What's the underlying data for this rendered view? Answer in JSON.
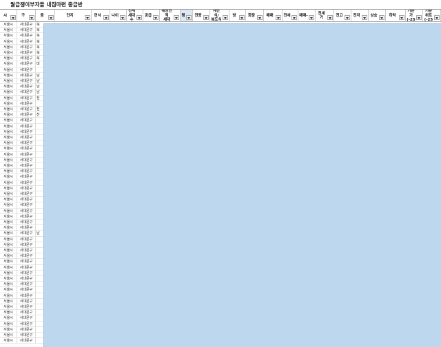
{
  "sheet": {
    "title": "월급쟁이부자들 내집마련 중급반"
  },
  "columns": [
    {
      "label": "시"
    },
    {
      "label": "구"
    },
    {
      "label": "동"
    },
    {
      "label": "단지"
    },
    {
      "label": "연식"
    },
    {
      "label": "나이"
    },
    {
      "label": "전체\n세대수"
    },
    {
      "label": "공급"
    },
    {
      "label": "해당면적\n세대"
    },
    {
      "label": "평"
    },
    {
      "label": "전용"
    },
    {
      "label": "계단식/\n복도식"
    },
    {
      "label": "방"
    },
    {
      "label": "화장"
    },
    {
      "label": "매매"
    },
    {
      "label": "전세"
    },
    {
      "label": "매매-"
    },
    {
      "label": "전세가"
    },
    {
      "label": "전고"
    },
    {
      "label": "전저"
    },
    {
      "label": "상승"
    },
    {
      "label": "하락"
    },
    {
      "label": "기준가\n(-25"
    },
    {
      "label": "기준위트\n(-25"
    }
  ],
  "rows": [
    {
      "city": "서울시",
      "district": "서대문구",
      "dong": "북"
    },
    {
      "city": "서울시",
      "district": "서대문구",
      "dong": "북"
    },
    {
      "city": "서울시",
      "district": "서대문구",
      "dong": "북"
    },
    {
      "city": "서울시",
      "district": "서대문구",
      "dong": "북"
    },
    {
      "city": "서울시",
      "district": "서대문구",
      "dong": "북"
    },
    {
      "city": "서울시",
      "district": "서대문구",
      "dong": "북"
    },
    {
      "city": "서울시",
      "district": "서대문구",
      "dong": "북"
    },
    {
      "city": "서울시",
      "district": "서대문구",
      "dong": "대"
    },
    {
      "city": "서울시",
      "district": "서대문구",
      "dong": ""
    },
    {
      "city": "서울시",
      "district": "서대문구",
      "dong": "남"
    },
    {
      "city": "서울시",
      "district": "서대문구",
      "dong": "남"
    },
    {
      "city": "서울시",
      "district": "서대문구",
      "dong": "남"
    },
    {
      "city": "서울시",
      "district": "서대문구",
      "dong": "남"
    },
    {
      "city": "서울시",
      "district": "서대문구",
      "dong": "천"
    },
    {
      "city": "서울시",
      "district": "서대문구",
      "dong": ""
    },
    {
      "city": "서울시",
      "district": "서대문구",
      "dong": "천"
    },
    {
      "city": "서울시",
      "district": "서대문구",
      "dong": "천"
    },
    {
      "city": "서울시",
      "district": "서대문구",
      "dong": ""
    },
    {
      "city": "서울시",
      "district": "서대문구",
      "dong": ""
    },
    {
      "city": "서울시",
      "district": "서대문구",
      "dong": ""
    },
    {
      "city": "서울시",
      "district": "서대문구",
      "dong": ""
    },
    {
      "city": "서울시",
      "district": "서대문구",
      "dong": ""
    },
    {
      "city": "서울시",
      "district": "서대문구",
      "dong": ""
    },
    {
      "city": "서울시",
      "district": "서대문구",
      "dong": ""
    },
    {
      "city": "서울시",
      "district": "서대문구",
      "dong": ""
    },
    {
      "city": "서울시",
      "district": "서대문구",
      "dong": ""
    },
    {
      "city": "서울시",
      "district": "서대문구",
      "dong": ""
    },
    {
      "city": "서울시",
      "district": "서대문구",
      "dong": ""
    },
    {
      "city": "서울시",
      "district": "서대문구",
      "dong": ""
    },
    {
      "city": "서울시",
      "district": "서대문구",
      "dong": ""
    },
    {
      "city": "서울시",
      "district": "서대문구",
      "dong": ""
    },
    {
      "city": "서울시",
      "district": "서대문구",
      "dong": ""
    },
    {
      "city": "서울시",
      "district": "서대문구",
      "dong": ""
    },
    {
      "city": "서울시",
      "district": "서대문구",
      "dong": ""
    },
    {
      "city": "서울시",
      "district": "서대문구",
      "dong": ""
    },
    {
      "city": "서울시",
      "district": "서대문구",
      "dong": ""
    },
    {
      "city": "서울시",
      "district": "서대문구",
      "dong": ""
    },
    {
      "city": "서울시",
      "district": "서대문구",
      "dong": "남"
    },
    {
      "city": "서울시",
      "district": "서대문구",
      "dong": ""
    },
    {
      "city": "서울시",
      "district": "서대문구",
      "dong": ""
    },
    {
      "city": "서울시",
      "district": "서대문구",
      "dong": ""
    },
    {
      "city": "서울시",
      "district": "서대문구",
      "dong": ""
    },
    {
      "city": "서울시",
      "district": "서대문구",
      "dong": ""
    },
    {
      "city": "서울시",
      "district": "서대문구",
      "dong": ""
    },
    {
      "city": "서울시",
      "district": "서대문구",
      "dong": ""
    },
    {
      "city": "서울시",
      "district": "서대문구",
      "dong": ""
    },
    {
      "city": "서울시",
      "district": "서대문구",
      "dong": ""
    },
    {
      "city": "서울시",
      "district": "서대문구",
      "dong": ""
    },
    {
      "city": "서울시",
      "district": "서대문구",
      "dong": ""
    },
    {
      "city": "서울시",
      "district": "서대문구",
      "dong": ""
    },
    {
      "city": "서울시",
      "district": "서대문구",
      "dong": ""
    },
    {
      "city": "서울시",
      "district": "서대문구",
      "dong": ""
    },
    {
      "city": "서울시",
      "district": "서대문구",
      "dong": ""
    },
    {
      "city": "서울시",
      "district": "서대문구",
      "dong": ""
    },
    {
      "city": "서울시",
      "district": "서대문구",
      "dong": ""
    },
    {
      "city": "서울시",
      "district": "서대문구",
      "dong": ""
    },
    {
      "city": "서울시",
      "district": "서대문구",
      "dong": ""
    }
  ],
  "icons": {
    "filter": "filter-dropdown-icon"
  },
  "colors": {
    "overlay": "#bdd7ee",
    "selected_header": "#dce8f5"
  }
}
